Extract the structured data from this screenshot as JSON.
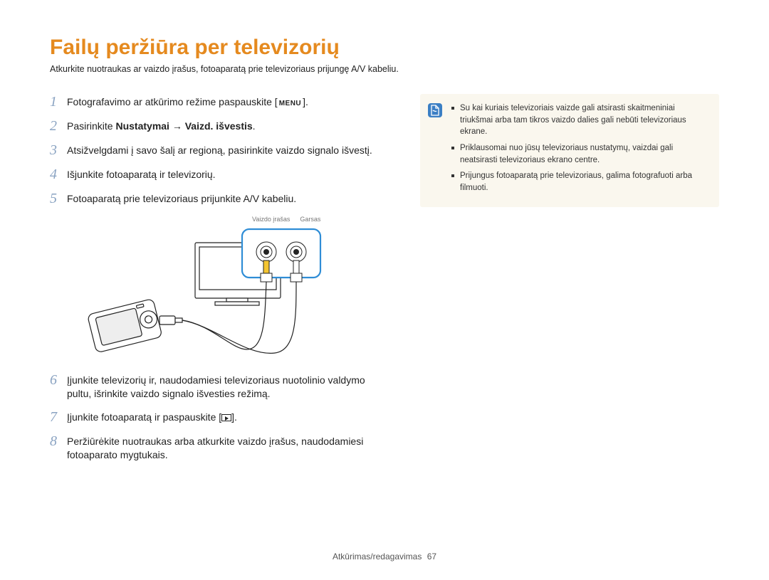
{
  "title": "Failų peržiūra per televizorių",
  "subtitle": "Atkurkite nuotraukas ar vaizdo įrašus, fotoaparatą prie televizoriaus prijungę A/V kabeliu.",
  "steps": [
    {
      "n": "1",
      "pre": "Fotografavimo ar atkūrimo režime paspauskite [",
      "kbd": "MENU",
      "post": "]."
    },
    {
      "n": "2",
      "text_pre": "Pasirinkite ",
      "bold": "Nustatymai → Vaizd. išvestis",
      "text_post": "."
    },
    {
      "n": "3",
      "text": "Atsižvelgdami į savo šalį ar regioną, pasirinkite vaizdo signalo išvestį."
    },
    {
      "n": "4",
      "text": "Išjunkite fotoaparatą ir televizorių."
    },
    {
      "n": "5",
      "text": "Fotoaparatą prie televizoriaus prijunkite A/V kabeliu."
    },
    {
      "n": "6",
      "text": "Įjunkite televizorių ir, naudodamiesi televizoriaus nuotolinio valdymo pultu, išrinkite vaizdo signalo išvesties režimą."
    },
    {
      "n": "7",
      "pre": "Įjunkite fotoaparatą ir paspauskite [",
      "play": true,
      "post": "]."
    },
    {
      "n": "8",
      "text": "Peržiūrėkite nuotraukas arba atkurkite vaizdo įrašus, naudodamiesi fotoaparato mygtukais."
    }
  ],
  "diagram_labels": {
    "video": "Vaizdo įrašas",
    "audio": "Garsas"
  },
  "notes": [
    "Su kai kuriais televizoriais vaizde gali atsirasti skaitmeniniai triukšmai arba tam tikros vaizdo dalies gali nebūti televizoriaus ekrane.",
    "Priklausomai nuo jūsų televizoriaus nustatymų, vaizdai gali neatsirasti televizoriaus ekrano centre.",
    "Prijungus fotoaparatą prie televizoriaus, galima fotografuoti arba filmuoti."
  ],
  "footer": {
    "section": "Atkūrimas/redagavimas",
    "page": "67"
  }
}
